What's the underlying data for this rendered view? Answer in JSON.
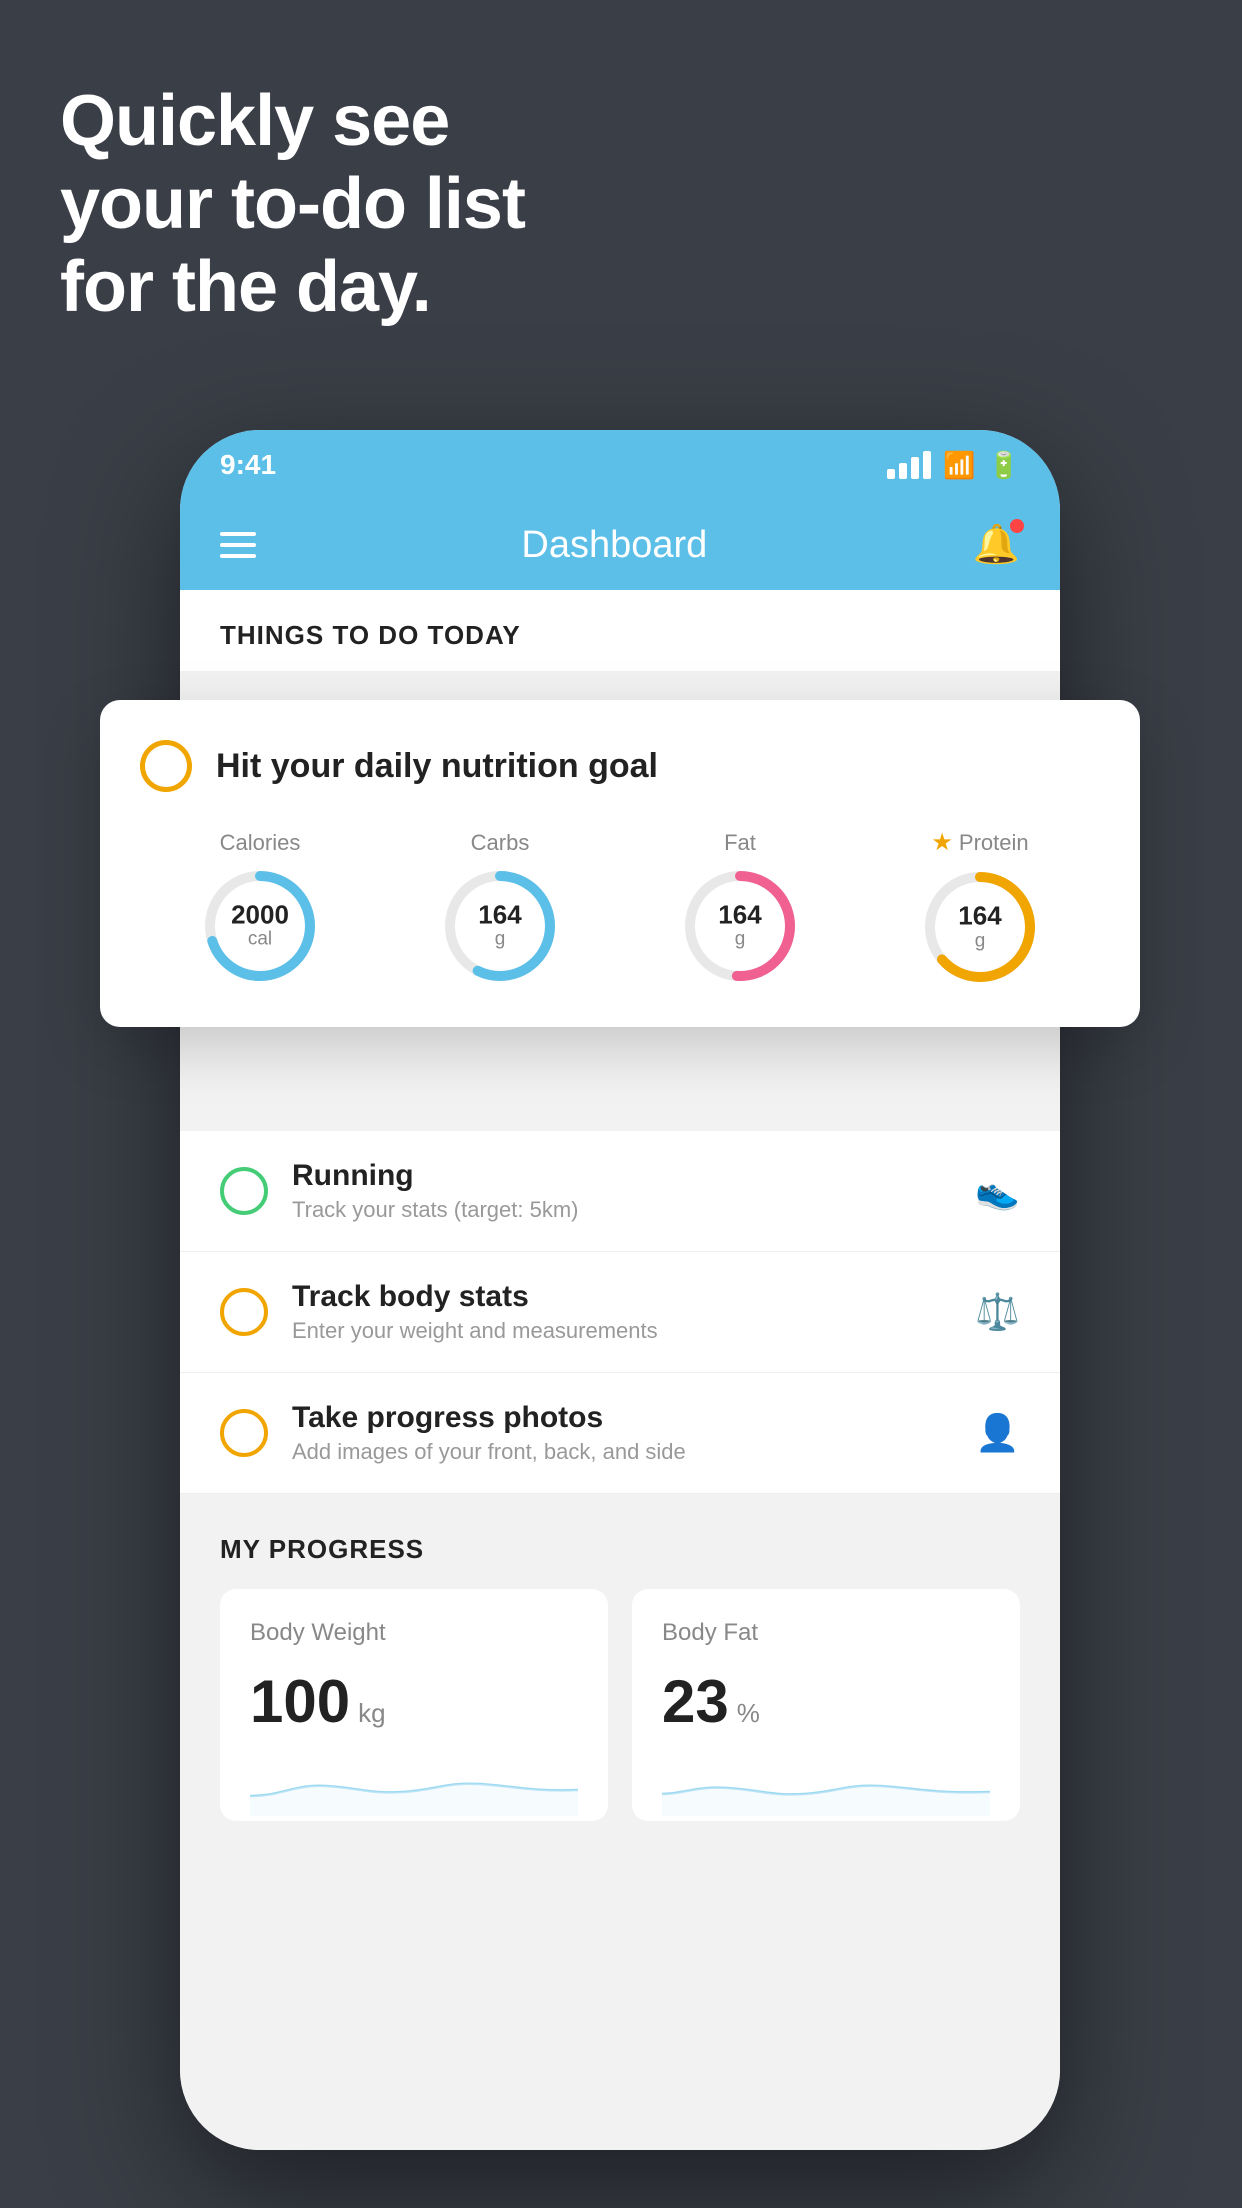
{
  "hero": {
    "line1": "Quickly see",
    "line2": "your to-do list",
    "line3": "for the day."
  },
  "status_bar": {
    "time": "9:41"
  },
  "nav": {
    "title": "Dashboard"
  },
  "things_today": {
    "header": "THINGS TO DO TODAY"
  },
  "nutrition_card": {
    "title": "Hit your daily nutrition goal",
    "items": [
      {
        "label": "Calories",
        "value": "2000",
        "unit": "cal",
        "color": "blue",
        "starred": false
      },
      {
        "label": "Carbs",
        "value": "164",
        "unit": "g",
        "color": "blue",
        "starred": false
      },
      {
        "label": "Fat",
        "value": "164",
        "unit": "g",
        "color": "pink",
        "starred": false
      },
      {
        "label": "Protein",
        "value": "164",
        "unit": "g",
        "color": "gold",
        "starred": true
      }
    ]
  },
  "todo_items": [
    {
      "title": "Running",
      "subtitle": "Track your stats (target: 5km)",
      "type": "green",
      "icon": "👟"
    },
    {
      "title": "Track body stats",
      "subtitle": "Enter your weight and measurements",
      "type": "yellow",
      "icon": "⚖️"
    },
    {
      "title": "Take progress photos",
      "subtitle": "Add images of your front, back, and side",
      "type": "yellow",
      "icon": "👤"
    }
  ],
  "progress": {
    "header": "MY PROGRESS",
    "cards": [
      {
        "title": "Body Weight",
        "value": "100",
        "unit": "kg"
      },
      {
        "title": "Body Fat",
        "value": "23",
        "unit": "%"
      }
    ]
  }
}
